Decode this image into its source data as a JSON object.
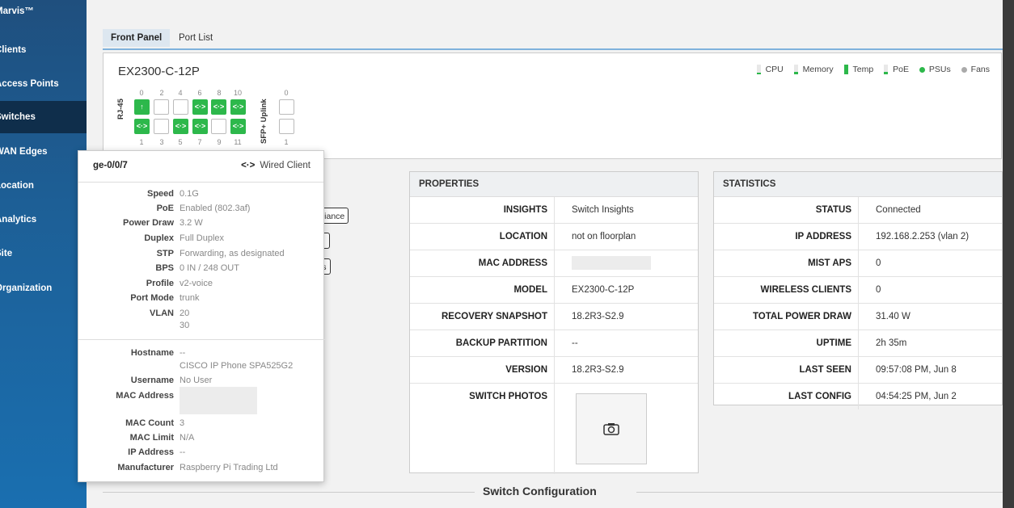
{
  "sidebar": {
    "items": [
      {
        "label": "Marvis™"
      },
      {
        "label": "Clients"
      },
      {
        "label": "Access Points"
      },
      {
        "label": "Switches",
        "active": true
      },
      {
        "label": "WAN Edges"
      },
      {
        "label": "Location"
      },
      {
        "label": "Analytics"
      },
      {
        "label": "Site"
      },
      {
        "label": "Organization"
      }
    ]
  },
  "tabs": {
    "front_panel": "Front Panel",
    "port_list": "Port List"
  },
  "front_panel": {
    "device_name": "EX2300-C-12P",
    "legend": {
      "cpu": "CPU",
      "memory": "Memory",
      "temp": "Temp",
      "poe": "PoE",
      "psus": "PSUs",
      "fans": "Fans"
    },
    "legend_colors": {
      "ok": "#2db84b",
      "inactive": "#aaaaaa"
    },
    "rj45_label": "RJ-45",
    "sfp_label": "SFP+ Uplink",
    "top_numbers": [
      "0",
      "2",
      "4",
      "6",
      "8",
      "10"
    ],
    "bottom_numbers": [
      "1",
      "3",
      "5",
      "7",
      "9",
      "11"
    ],
    "sfp_top_number": "0",
    "sfp_bottom_number": "1",
    "port_icons": {
      "uplink": "↑",
      "client": "<·>"
    }
  },
  "partial_card": {
    "btn1": "pliance",
    "btn3": "ss"
  },
  "properties": {
    "title": "PROPERTIES",
    "rows": [
      {
        "key": "INSIGHTS",
        "value": "Switch Insights"
      },
      {
        "key": "LOCATION",
        "value": "not on floorplan"
      },
      {
        "key": "MAC ADDRESS",
        "value": ""
      },
      {
        "key": "MODEL",
        "value": "EX2300-C-12P"
      },
      {
        "key": "RECOVERY SNAPSHOT",
        "value": "18.2R3-S2.9"
      },
      {
        "key": "BACKUP PARTITION",
        "value": "--"
      },
      {
        "key": "VERSION",
        "value": "18.2R3-S2.9"
      },
      {
        "key": "SWITCH PHOTOS",
        "value": ""
      }
    ]
  },
  "statistics": {
    "title": "STATISTICS",
    "rows": [
      {
        "key": "STATUS",
        "value": "Connected"
      },
      {
        "key": "IP ADDRESS",
        "value": "192.168.2.253  (vlan 2)"
      },
      {
        "key": "MIST APS",
        "value": "0"
      },
      {
        "key": "WIRELESS CLIENTS",
        "value": "0"
      },
      {
        "key": "TOTAL POWER DRAW",
        "value": "31.40 W"
      },
      {
        "key": "UPTIME",
        "value": "2h 35m"
      },
      {
        "key": "LAST SEEN",
        "value": "09:57:08 PM, Jun 8"
      },
      {
        "key": "LAST CONFIG",
        "value": "04:54:25 PM, Jun 2"
      }
    ]
  },
  "tooltip": {
    "port": "ge-0/0/7",
    "type_icon": "<·>",
    "type": "Wired Client",
    "rows": [
      {
        "key": "Speed",
        "value": "0.1G"
      },
      {
        "key": "PoE",
        "value": "Enabled (802.3af)"
      },
      {
        "key": "Power Draw",
        "value": "3.2 W"
      },
      {
        "key": "Duplex",
        "value": "Full Duplex"
      },
      {
        "key": "STP",
        "value": "Forwarding, as designated"
      },
      {
        "key": "BPS",
        "value": "0 IN / 248 OUT"
      },
      {
        "key": "Profile",
        "value": "v2-voice"
      },
      {
        "key": "Port Mode",
        "value": "trunk"
      },
      {
        "key": "VLAN",
        "value": "20"
      }
    ],
    "vlan_extra": "30",
    "client_rows": [
      {
        "key": "Hostname",
        "value": "--"
      },
      {
        "key": "",
        "value": "CISCO IP Phone SPA525G2"
      },
      {
        "key": "Username",
        "value": "No User"
      },
      {
        "key": "MAC Address",
        "value": ""
      },
      {
        "key": "MAC Count",
        "value": "3"
      },
      {
        "key": "MAC Limit",
        "value": "N/A"
      },
      {
        "key": "IP Address",
        "value": "--"
      },
      {
        "key": "Manufacturer",
        "value": "Raspberry Pi Trading Ltd"
      }
    ]
  },
  "switch_configuration": "Switch Configuration"
}
